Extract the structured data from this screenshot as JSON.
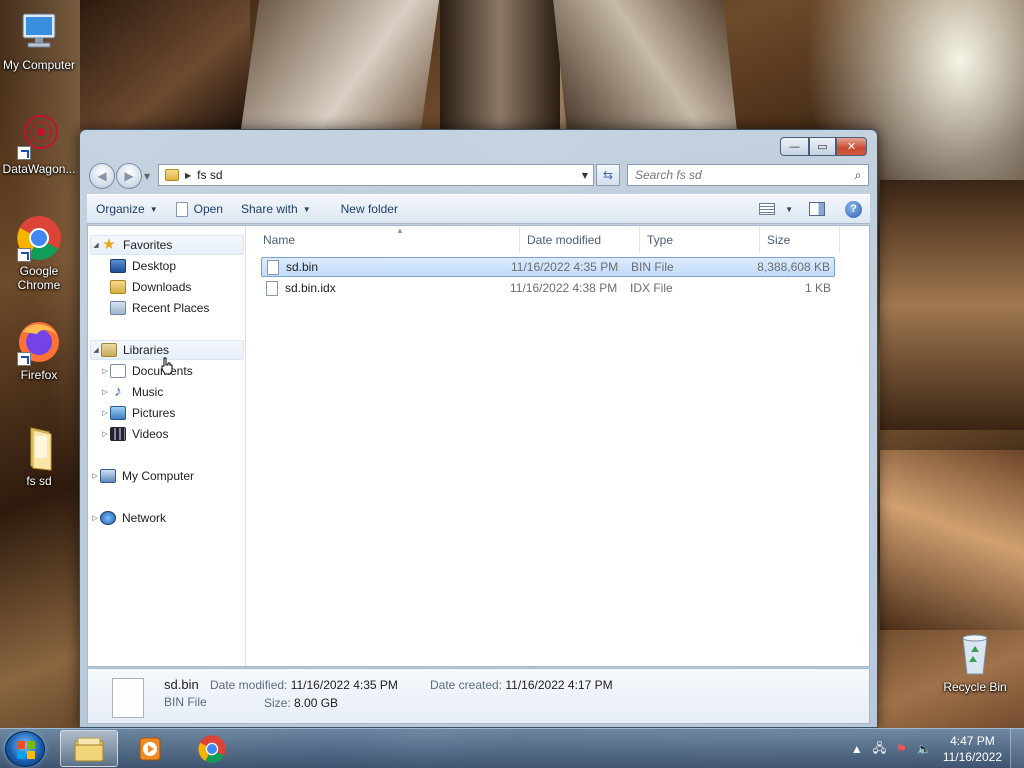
{
  "desktop": {
    "icons": [
      {
        "label": "My Computer"
      },
      {
        "label": "DataWagon..."
      },
      {
        "label": "Google Chrome"
      },
      {
        "label": "Firefox"
      },
      {
        "label": "fs sd"
      },
      {
        "label": "Recycle Bin"
      }
    ]
  },
  "window": {
    "caption": {
      "minimize": "—",
      "maximize": "▭",
      "close": "✕"
    },
    "address": {
      "path": "fs sd"
    },
    "search": {
      "placeholder": "Search fs sd"
    },
    "toolbar": {
      "organize": "Organize",
      "open": "Open",
      "share_with": "Share with",
      "new_folder": "New folder"
    },
    "nav": {
      "favorites": "Favorites",
      "desktop": "Desktop",
      "downloads": "Downloads",
      "recent_places": "Recent Places",
      "libraries": "Libraries",
      "documents": "Documents",
      "music": "Music",
      "pictures": "Pictures",
      "videos": "Videos",
      "my_computer": "My Computer",
      "network": "Network"
    },
    "columns": {
      "name": "Name",
      "date": "Date modified",
      "type": "Type",
      "size": "Size"
    },
    "files": [
      {
        "name": "sd.bin",
        "date": "11/16/2022 4:35 PM",
        "type": "BIN File",
        "size": "8,388,608 KB",
        "selected": true
      },
      {
        "name": "sd.bin.idx",
        "date": "11/16/2022 4:38 PM",
        "type": "IDX File",
        "size": "1 KB",
        "selected": false
      }
    ],
    "details": {
      "name": "sd.bin",
      "type": "BIN File",
      "date_modified_label": "Date modified:",
      "date_modified": "11/16/2022 4:35 PM",
      "date_created_label": "Date created:",
      "date_created": "11/16/2022 4:17 PM",
      "size_label": "Size:",
      "size": "8.00 GB"
    }
  },
  "taskbar": {
    "time": "4:47 PM",
    "date": "11/16/2022"
  },
  "colors": {
    "selection": "#cde4fc",
    "accent": "#1e3f66",
    "close_button": "#c74a30"
  }
}
